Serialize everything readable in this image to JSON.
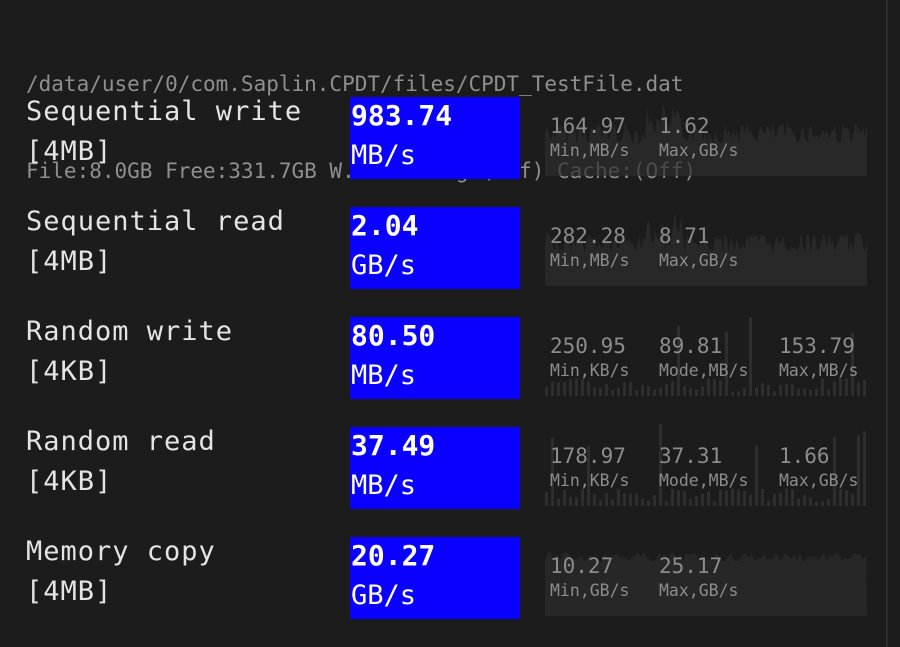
{
  "header": {
    "path": "/data/user/0/com.Saplin.CPDT/files/CPDT_TestFile.dat",
    "info": "File:8.0GB Free:331.7GB W.Buffering:(Off) Cache:(Off)"
  },
  "colors": {
    "background": "#1c1c1c",
    "result_box": "#0a00ff",
    "label": "#e4e4e4",
    "muted": "#8c8c8c",
    "graph": "#2e2e2e"
  },
  "tests": [
    {
      "name": "Sequential write",
      "block": "[4MB]",
      "value": "983.74",
      "unit": "MB/s",
      "stats": [
        {
          "num": "164.97",
          "cap": "Min,MB/s"
        },
        {
          "num": "1.62",
          "cap": "Max,GB/s"
        }
      ]
    },
    {
      "name": "Sequential read",
      "block": "[4MB]",
      "value": "2.04",
      "unit": "GB/s",
      "stats": [
        {
          "num": "282.28",
          "cap": "Min,MB/s"
        },
        {
          "num": "8.71",
          "cap": "Max,GB/s"
        }
      ]
    },
    {
      "name": "Random write",
      "block": "[4KB]",
      "value": "80.50",
      "unit": "MB/s",
      "stats": [
        {
          "num": "250.95",
          "cap": "Min,KB/s"
        },
        {
          "num": "89.81",
          "cap": "Mode,MB/s"
        },
        {
          "num": "153.79",
          "cap": "Max,MB/s"
        }
      ]
    },
    {
      "name": "Random read",
      "block": "[4KB]",
      "value": "37.49",
      "unit": "MB/s",
      "stats": [
        {
          "num": "178.97",
          "cap": "Min,KB/s"
        },
        {
          "num": "37.31",
          "cap": "Mode,MB/s"
        },
        {
          "num": "1.66",
          "cap": "Max,GB/s"
        }
      ]
    },
    {
      "name": "Memory copy",
      "block": "[4MB]",
      "value": "20.27",
      "unit": "GB/s",
      "stats": [
        {
          "num": "10.27",
          "cap": "Min,GB/s"
        },
        {
          "num": "25.17",
          "cap": "Max,GB/s"
        }
      ]
    }
  ]
}
